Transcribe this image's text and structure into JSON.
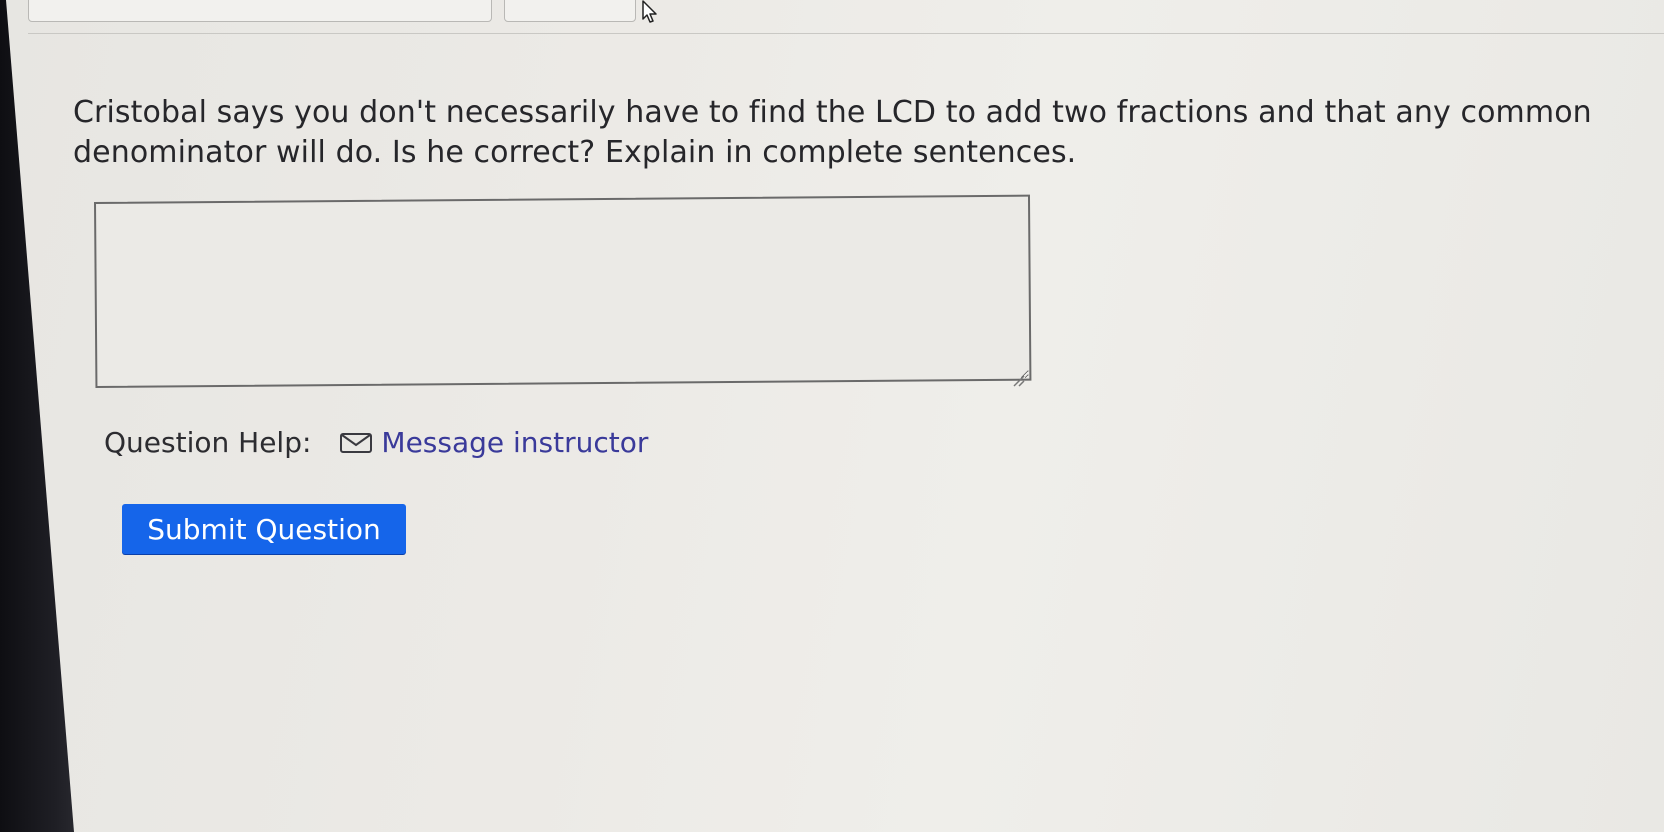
{
  "question": {
    "line_1": "Cristobal says you don't necessarily have to find the LCD to add two fractions and that any common",
    "line_2": "denominator will do. Is he correct? Explain in complete sentences."
  },
  "answer": {
    "value": "",
    "placeholder": ""
  },
  "help": {
    "label": "Question Help:",
    "icon": "envelope-icon",
    "link_text": "Message instructor"
  },
  "submit": {
    "label": "Submit Question"
  },
  "colors": {
    "button_blue": "#1565ea",
    "link_purple": "#3a3a9a",
    "text_dark": "#26262a",
    "page_background": "#eceae6"
  }
}
